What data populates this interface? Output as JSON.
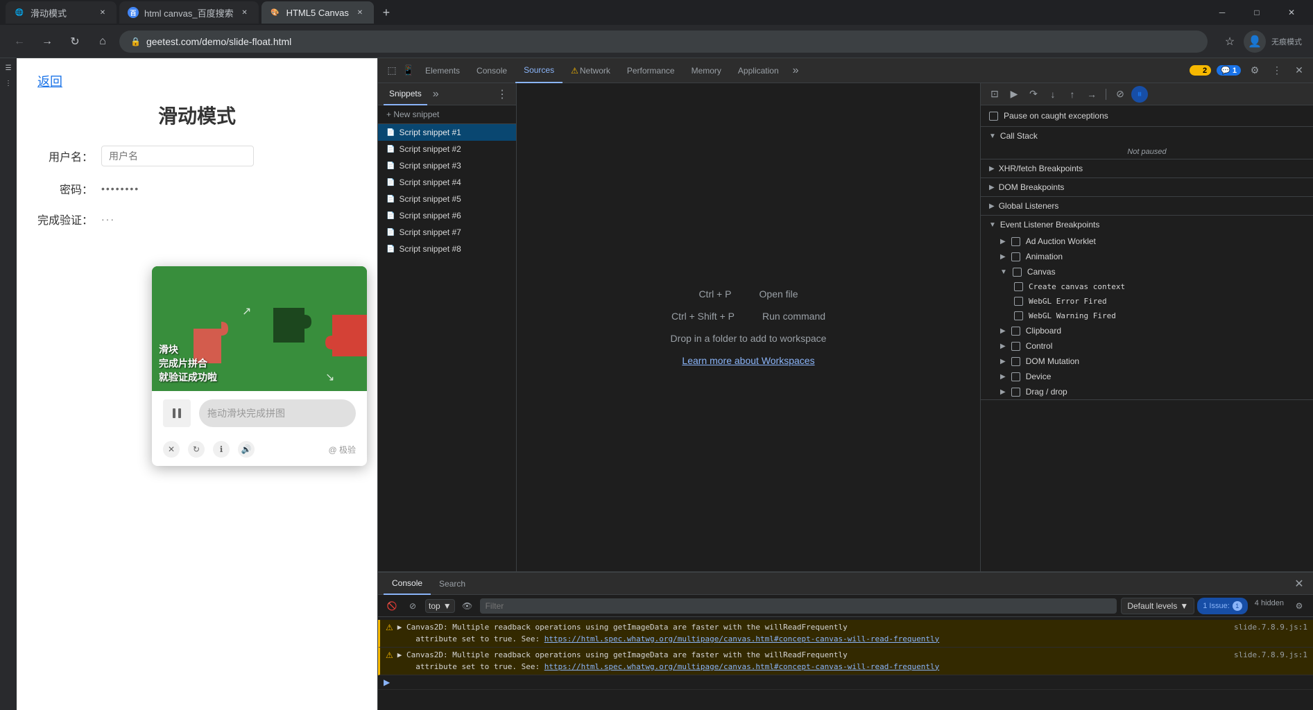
{
  "browser": {
    "tabs": [
      {
        "id": "tab1",
        "title": "滑动模式",
        "favicon": "🌐",
        "active": false
      },
      {
        "id": "tab2",
        "title": "html canvas_百度搜索",
        "favicon": "🅱",
        "active": false
      },
      {
        "id": "tab3",
        "title": "HTML5 Canvas",
        "favicon": "🎨",
        "active": true
      }
    ],
    "address": "geetest.com/demo/slide-float.html",
    "incognito_label": "无痕模式"
  },
  "webpage": {
    "back_link": "返回",
    "title": "滑动模式",
    "username_label": "用户名：",
    "username_placeholder": "用户名",
    "password_label": "密码：",
    "password_value": "••••••••",
    "verify_label": "完成验证：",
    "verify_value": "···"
  },
  "captcha": {
    "overlay_line1": "滑块",
    "overlay_line2": "完成片拼合",
    "overlay_line3": "就验证成功啦",
    "slider_hint": "拖动滑块完成拼图",
    "brand": "@ 极验"
  },
  "devtools": {
    "tabs": [
      "Elements",
      "Console",
      "Sources",
      "Network",
      "Performance",
      "Memory",
      "Application"
    ],
    "active_tab": "Sources",
    "warning_count": "2",
    "info_count": "1",
    "sources_panel": {
      "sidebar_tab": "Snippets",
      "new_snippet": "+ New snippet",
      "snippets": [
        "Script snippet #1",
        "Script snippet #2",
        "Script snippet #3",
        "Script snippet #4",
        "Script snippet #5",
        "Script snippet #6",
        "Script snippet #7",
        "Script snippet #8"
      ],
      "editor": {
        "shortcut1_key": "Ctrl + P",
        "shortcut1_action": "Open file",
        "shortcut2_key": "Ctrl + Shift + P",
        "shortcut2_action": "Run command",
        "drop_text": "Drop in a folder to add to workspace",
        "link_text": "Learn more about Workspaces"
      }
    },
    "breakpoints": {
      "pause_exception_label": "Pause on caught exceptions",
      "not_paused": "Not paused",
      "call_stack_title": "Call Stack",
      "call_stack_status": "Not paused",
      "sections": [
        {
          "id": "xhr",
          "title": "XHR/fetch Breakpoints",
          "expanded": false
        },
        {
          "id": "dom",
          "title": "DOM Breakpoints",
          "expanded": false
        },
        {
          "id": "global",
          "title": "Global Listeners",
          "expanded": false
        },
        {
          "id": "event",
          "title": "Event Listener Breakpoints",
          "expanded": true,
          "items": [
            {
              "label": "Ad Auction Worklet",
              "checked": false,
              "indent": 1
            },
            {
              "label": "Animation",
              "checked": false,
              "indent": 1
            },
            {
              "label": "Canvas",
              "checked": false,
              "indent": 1,
              "expanded": true,
              "children": [
                {
                  "label": "Create canvas context",
                  "checked": false,
                  "mono": true
                },
                {
                  "label": "WebGL Error Fired",
                  "checked": false,
                  "mono": true
                },
                {
                  "label": "WebGL Warning Fired",
                  "checked": false,
                  "mono": true
                }
              ]
            },
            {
              "label": "Clipboard",
              "checked": false,
              "indent": 1
            },
            {
              "label": "Control",
              "checked": false,
              "indent": 1
            },
            {
              "label": "DOM Mutation",
              "checked": false,
              "indent": 1
            },
            {
              "label": "Device",
              "checked": false,
              "indent": 1
            },
            {
              "label": "Drag / drop",
              "checked": false,
              "indent": 1
            }
          ]
        }
      ]
    }
  },
  "console": {
    "tabs": [
      "Console",
      "Search"
    ],
    "active_tab": "Console",
    "context": "top",
    "filter_placeholder": "Filter",
    "default_levels": "Default levels",
    "issue_label": "1 Issue:",
    "issue_count": "1",
    "hidden_count": "4 hidden",
    "messages": [
      {
        "type": "warning",
        "text": "▶ Canvas2D: Multiple readback operations using getImageData are faster with the willReadFrequently",
        "continuation": "attribute set to true. See:",
        "link": "https://html.spec.whatwg.org/multipage/canvas.html#concept-canvas-will-read-frequently",
        "file": "slide.7.8.9.js:1"
      },
      {
        "type": "warning",
        "text": "▶ Canvas2D: Multiple readback operations using getImageData are faster with the willReadFrequently",
        "continuation": "attribute set to true. See:",
        "link": "https://html.spec.whatwg.org/multipage/canvas.html#concept-canvas-will-read-frequently",
        "file": "slide.7.8.9.js:1"
      }
    ]
  }
}
